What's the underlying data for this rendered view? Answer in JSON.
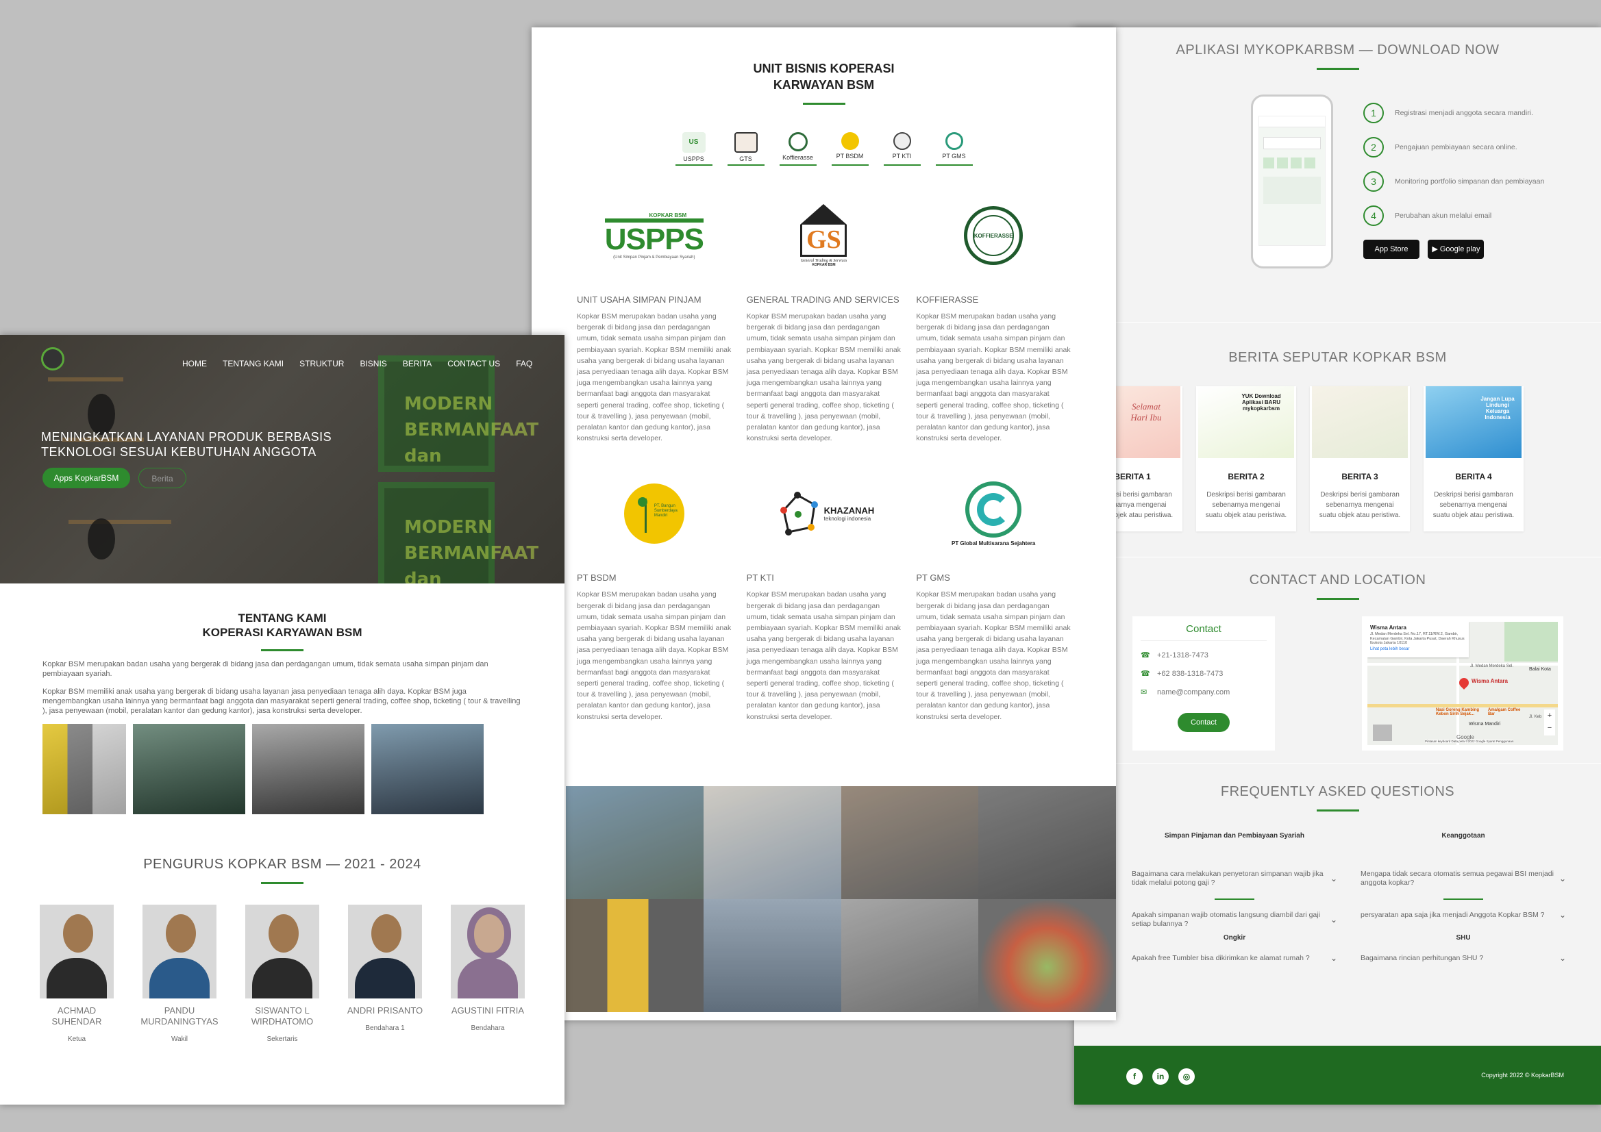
{
  "home": {
    "nav": [
      "HOME",
      "TENTANG KAMI",
      "STRUKTUR",
      "BISNIS",
      "BERITA",
      "CONTACT US",
      "FAQ"
    ],
    "hero_title": "MENINGKATKAN LAYANAN PRODUK BERBASIS TEKNOLOGI SESUAI KEBUTUHAN ANGGOTA",
    "btn_apps": "Apps KopkarBSM",
    "btn_berita": "Berita",
    "deco_text": "MODERN BERMANFAAT dan",
    "about_title_1": "TENTANG KAMI",
    "about_title_2": "KOPERASI KARYAWAN BSM",
    "about_p1": "Kopkar BSM merupakan badan usaha yang bergerak di bidang jasa dan perdagangan umum, tidak semata usaha simpan pinjam dan pembiayaan syariah.",
    "about_p2": "Kopkar BSM memiliki anak usaha yang bergerak di bidang usaha layanan jasa penyediaan tenaga alih daya. Kopkar BSM juga mengembangkan usaha lainnya yang bermanfaat bagi anggota dan masyarakat seperti general trading, coffee shop, ticketing ( tour & travelling ), jasa penyewaan (mobil, peralatan kantor dan gedung kantor), jasa konstruksi serta developer.",
    "team_title": "PENGURUS KOPKAR BSM — 2021 - 2024",
    "team": [
      {
        "name": "ACHMAD SUHENDAR",
        "role": "Ketua"
      },
      {
        "name": "PANDU MURDANINGTYAS",
        "role": "Wakil"
      },
      {
        "name": "SISWANTO L WIRDHATOMO",
        "role": "Sekertaris"
      },
      {
        "name": "ANDRI PRISANTO",
        "role": "Bendahara 1"
      },
      {
        "name": "AGUSTINI FITRIA",
        "role": "Bendahara"
      }
    ]
  },
  "units": {
    "title_1": "UNIT BISNIS KOPERASI",
    "title_2": "KARWAYAN BSM",
    "mini": [
      "USPPS",
      "GTS",
      "Koffierasse",
      "PT BSDM",
      "PT KTI",
      "PT GMS"
    ],
    "logo_usp_top": "KOPKAR BSM",
    "logo_usp": "USPPS",
    "logo_usp_sub": "(Unit Simpan Pinjam & Pembiayaan Syariah)",
    "logo_gts": "GS",
    "logo_gts_sub": "General Trading & Services",
    "logo_gts_sub2": "KOPKAR BSM",
    "logo_koffie": "KOFFIERASSE",
    "logo_bsdm": "PT. Bangun Sumberdaya Mandiri",
    "logo_kti": "KHAZANAH",
    "logo_kti_sub": "teknologi indonesia",
    "logo_gms": "PT Global Multisarana Sejahtera",
    "items": [
      {
        "title": "UNIT USAHA SIMPAN PINJAM",
        "text": "Kopkar BSM merupakan badan usaha yang bergerak di bidang jasa dan perdagangan umum, tidak semata usaha simpan pinjam dan pembiayaan syariah. Kopkar BSM memiliki anak usaha yang bergerak di bidang usaha layanan jasa penyediaan tenaga alih daya. Kopkar BSM juga mengembangkan usaha lainnya yang bermanfaat bagi anggota dan masyarakat seperti general trading, coffee shop, ticketing ( tour & travelling ), jasa penyewaan (mobil, peralatan kantor dan gedung kantor), jasa konstruksi serta developer."
      },
      {
        "title": "GENERAL TRADING AND SERVICES",
        "text": "Kopkar BSM merupakan badan usaha yang bergerak di bidang jasa dan perdagangan umum, tidak semata usaha simpan pinjam dan pembiayaan syariah. Kopkar BSM memiliki anak usaha yang bergerak di bidang usaha layanan jasa penyediaan tenaga alih daya. Kopkar BSM juga mengembangkan usaha lainnya yang bermanfaat bagi anggota dan masyarakat seperti general trading, coffee shop, ticketing ( tour & travelling ), jasa penyewaan (mobil, peralatan kantor dan gedung kantor), jasa konstruksi serta developer."
      },
      {
        "title": "KOFFIERASSE",
        "text": "Kopkar BSM merupakan badan usaha yang bergerak di bidang jasa dan perdagangan umum, tidak semata usaha simpan pinjam dan pembiayaan syariah. Kopkar BSM memiliki anak usaha yang bergerak di bidang usaha layanan jasa penyediaan tenaga alih daya. Kopkar BSM juga mengembangkan usaha lainnya yang bermanfaat bagi anggota dan masyarakat seperti general trading, coffee shop, ticketing ( tour & travelling ), jasa penyewaan (mobil, peralatan kantor dan gedung kantor), jasa konstruksi serta developer."
      },
      {
        "title": "PT BSDM",
        "text": "Kopkar BSM merupakan badan usaha yang bergerak di bidang jasa dan perdagangan umum, tidak semata usaha simpan pinjam dan pembiayaan syariah. Kopkar BSM memiliki anak usaha yang bergerak di bidang usaha layanan jasa penyediaan tenaga alih daya. Kopkar BSM juga mengembangkan usaha lainnya yang bermanfaat bagi anggota dan masyarakat seperti general trading, coffee shop, ticketing ( tour & travelling ), jasa penyewaan (mobil, peralatan kantor dan gedung kantor), jasa konstruksi serta developer."
      },
      {
        "title": "PT KTI",
        "text": "Kopkar BSM merupakan badan usaha yang bergerak di bidang jasa dan perdagangan umum, tidak semata usaha simpan pinjam dan pembiayaan syariah. Kopkar BSM memiliki anak usaha yang bergerak di bidang usaha layanan jasa penyediaan tenaga alih daya. Kopkar BSM juga mengembangkan usaha lainnya yang bermanfaat bagi anggota dan masyarakat seperti general trading, coffee shop, ticketing ( tour & travelling ), jasa penyewaan (mobil, peralatan kantor dan gedung kantor), jasa konstruksi serta developer."
      },
      {
        "title": "PT GMS",
        "text": "Kopkar BSM merupakan badan usaha yang bergerak di bidang jasa dan perdagangan umum, tidak semata usaha simpan pinjam dan pembiayaan syariah. Kopkar BSM memiliki anak usaha yang bergerak di bidang usaha layanan jasa penyediaan tenaga alih daya. Kopkar BSM juga mengembangkan usaha lainnya yang bermanfaat bagi anggota dan masyarakat seperti general trading, coffee shop, ticketing ( tour & travelling ), jasa penyewaan (mobil, peralatan kantor dan gedung kantor), jasa konstruksi serta developer."
      }
    ]
  },
  "app": {
    "title": "APLIKASI MYKOPKARBSM — DOWNLOAD NOW",
    "steps": [
      "Registrasi menjadi anggota secara mandiri.",
      "Pengajuan pembiayaan secara online.",
      "Monitoring portfolio simpanan dan pembiayaan",
      "Perubahan akun melalui email"
    ],
    "step_nums": [
      "1",
      "2",
      "3",
      "4"
    ],
    "appstore": "App Store",
    "googleplay": "Google play"
  },
  "news": {
    "title": "BERITA SEPUTAR KOPKAR BSM",
    "img_text": [
      "Selamat Hari Ibu",
      "YUK Download Aplikasi BARU mykopkarbsm",
      "",
      "Jangan Lupa Lindungi Keluarga Indonesia"
    ],
    "items": [
      {
        "title": "BERITA 1",
        "desc": "Deskripsi berisi gambaran sebenarnya mengenai suatu objek atau peristiwa."
      },
      {
        "title": "BERITA 2",
        "desc": "Deskripsi berisi gambaran sebenarnya mengenai suatu objek atau peristiwa."
      },
      {
        "title": "BERITA 3",
        "desc": "Deskripsi berisi gambaran sebenarnya mengenai suatu objek atau peristiwa."
      },
      {
        "title": "BERITA 4",
        "desc": "Deskripsi berisi gambaran sebenarnya mengenai suatu objek atau peristiwa."
      }
    ]
  },
  "contact": {
    "title": "CONTACT AND LOCATION",
    "box_title": "Contact",
    "phone1": "+21-1318-7473",
    "phone2": "+62 838-1318-7473",
    "email": "name@company.com",
    "button": "Contact",
    "map_place": "Wisma Antara",
    "map_address": "Jl. Medan Merdeka Sel. No.17, RT.11/RW.2, Gambir, Kecamatan Gambir, Kota Jakarta Pusat, Daerah Khusus Ibukota Jakarta 10110",
    "map_link": "Lihat peta lebih besar",
    "map_pin": "Wisma Antara",
    "map_pois": [
      "Balai Kota",
      "Nasi Goreng Kambing Kebon Sirih Sejak...",
      "Amalgam Coffee Bar",
      "Wisma Mandiri",
      "Jl. Medan Merdeka Sel.",
      "Jl. Keb"
    ],
    "map_footer": "Pintasan keyboard   Data peta ©2022 Google   Syarat Penggunaan",
    "map_google": "Google"
  },
  "faq": {
    "title": "FREQUENTLY ASKED QUESTIONS",
    "cat1": "Simpan Pinjaman dan Pembiayaan Syariah",
    "cat2": "Keanggotaan",
    "cat3": "Ongkir",
    "cat4": "SHU",
    "q1": "Bagaimana cara melakukan penyetoran simpanan wajib jika tidak melalui potong gaji ?",
    "q2": "Apakah simpanan wajib otomatis langsung diambil dari gaji setiap bulannya ?",
    "q3": "Mengapa tidak secara otomatis semua pegawai BSI menjadi anggota kopkar?",
    "q4": "persyaratan apa saja jika menjadi Anggota Kopkar BSM ?",
    "q5": "Apakah free Tumbler bisa dikirimkan ke alamat rumah ?",
    "q6": "Bagaimana rincian perhitungan SHU ?"
  },
  "footer": {
    "copyright": "Copyright 2022 © KopkarBSM",
    "social": [
      "f",
      "in",
      "◎"
    ]
  },
  "colors": {
    "brand_green": "#2e8b2e",
    "footer_green": "#1f6a21"
  }
}
